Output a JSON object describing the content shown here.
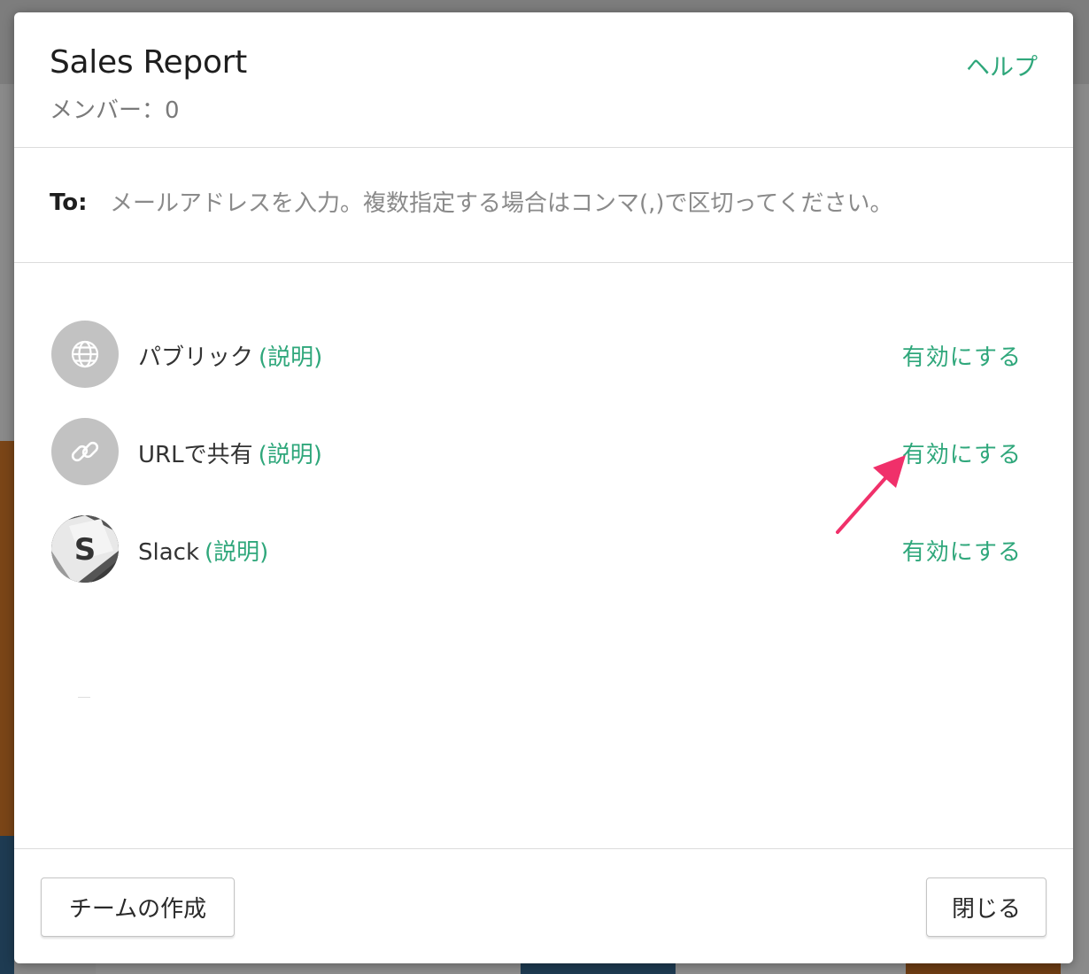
{
  "modal": {
    "title": "Sales Report",
    "member_count": "メンバー：0",
    "help_label": "ヘルプ"
  },
  "recipient": {
    "label": "To:",
    "placeholder": "メールアドレスを入力。複数指定する場合はコンマ(,)で区切ってください。"
  },
  "share_options": [
    {
      "name": "パブリック",
      "desc_label": "(説明)",
      "action_label": "有効にする",
      "icon": "globe-icon"
    },
    {
      "name": "URLで共有",
      "desc_label": "(説明)",
      "action_label": "有効にする",
      "icon": "link-icon"
    },
    {
      "name": "Slack",
      "desc_label": "(説明)",
      "action_label": "有効にする",
      "icon": "slack-icon"
    }
  ],
  "footer": {
    "create_team_label": "チームの作成",
    "close_label": "閉じる"
  },
  "colors": {
    "accent": "#2fa77b",
    "annotation_arrow": "#f0306a",
    "icon_bg": "#c2c2c2"
  }
}
